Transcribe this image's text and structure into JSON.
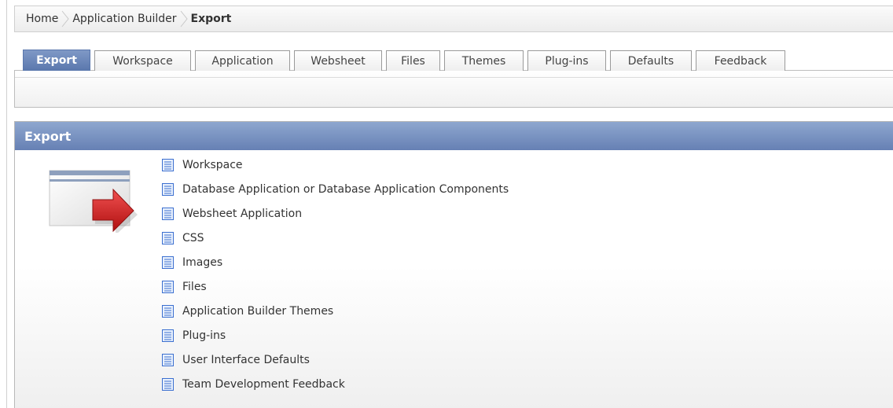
{
  "breadcrumb": {
    "items": [
      "Home",
      "Application Builder",
      "Export"
    ]
  },
  "tabs": [
    {
      "label": "Export",
      "active": true
    },
    {
      "label": "Workspace"
    },
    {
      "label": "Application"
    },
    {
      "label": "Websheet"
    },
    {
      "label": "Files"
    },
    {
      "label": "Themes"
    },
    {
      "label": "Plug-ins"
    },
    {
      "label": "Defaults"
    },
    {
      "label": "Feedback"
    }
  ],
  "region": {
    "title": "Export",
    "links": [
      "Workspace",
      "Database Application or Database Application Components",
      "Websheet Application",
      "CSS",
      "Images",
      "Files",
      "Application Builder Themes",
      "Plug-ins",
      "User Interface Defaults",
      "Team Development Feedback"
    ]
  },
  "icons": {
    "link_icon": "document-icon",
    "region_graphic": "export-arrow-icon",
    "breadcrumb_separator": "chevron-right-icon"
  },
  "colors": {
    "accent": "#6680b4",
    "arrow": "#d42020"
  }
}
